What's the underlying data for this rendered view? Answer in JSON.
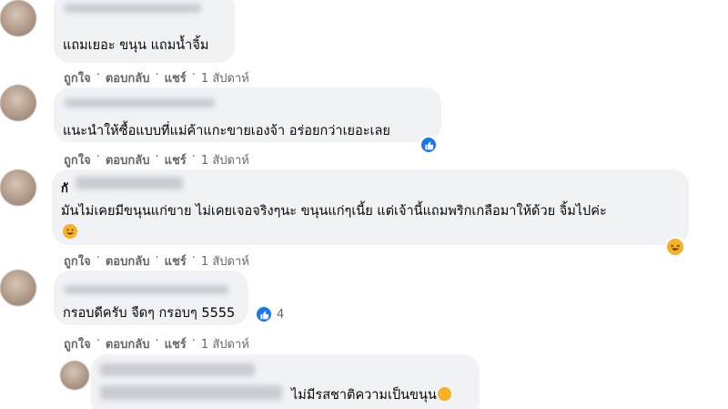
{
  "comments": [
    {
      "text": "แถมเยอะ ขนุน แถมน้ำจิ้ม",
      "actions": {
        "like": "ถูกใจ",
        "reply": "ตอบกลับ",
        "share": "แชร์",
        "time": "1 สัปดาห์"
      }
    },
    {
      "text": "แนะนำให้ซื้อแบบที่แม่ค้าแกะขายเองจ้า อร่อยกว่าเยอะเลย",
      "reaction": "like-icon",
      "actions": {
        "like": "ถูกใจ",
        "reply": "ตอบกลับ",
        "share": "แชร์",
        "time": "1 สัปดาห์"
      }
    },
    {
      "name_visible": "กั",
      "text": "มันไม่เคยมีขนุนแก่ขาย ไม่เคยเจอจริงๆนะ ขนุนแก่ๆเนี้ย แต่เจ้านี้แถมพริกเกลือมาให้ด้วย จิ้มไปค่ะ",
      "reaction": "haha-icon",
      "actions": {
        "like": "ถูกใจ",
        "reply": "ตอบกลับ",
        "share": "แชร์",
        "time": "1 สัปดาห์"
      }
    },
    {
      "text": "กรอบดีครับ จืดๆ กรอบๆ 5555",
      "reaction": "like-icon",
      "reaction_count": "4",
      "actions": {
        "like": "ถูกใจ",
        "reply": "ตอบกลับ",
        "share": "แชร์",
        "time": "1 สัปดาห์"
      }
    },
    {
      "text": "ไม่มีรสชาติความเป็นขนุน"
    }
  ],
  "colors": {
    "bubble": "#f0f2f5",
    "meta_text": "#65676b",
    "like_blue": "#1877f2",
    "haha_yellow": "#f7b125"
  }
}
